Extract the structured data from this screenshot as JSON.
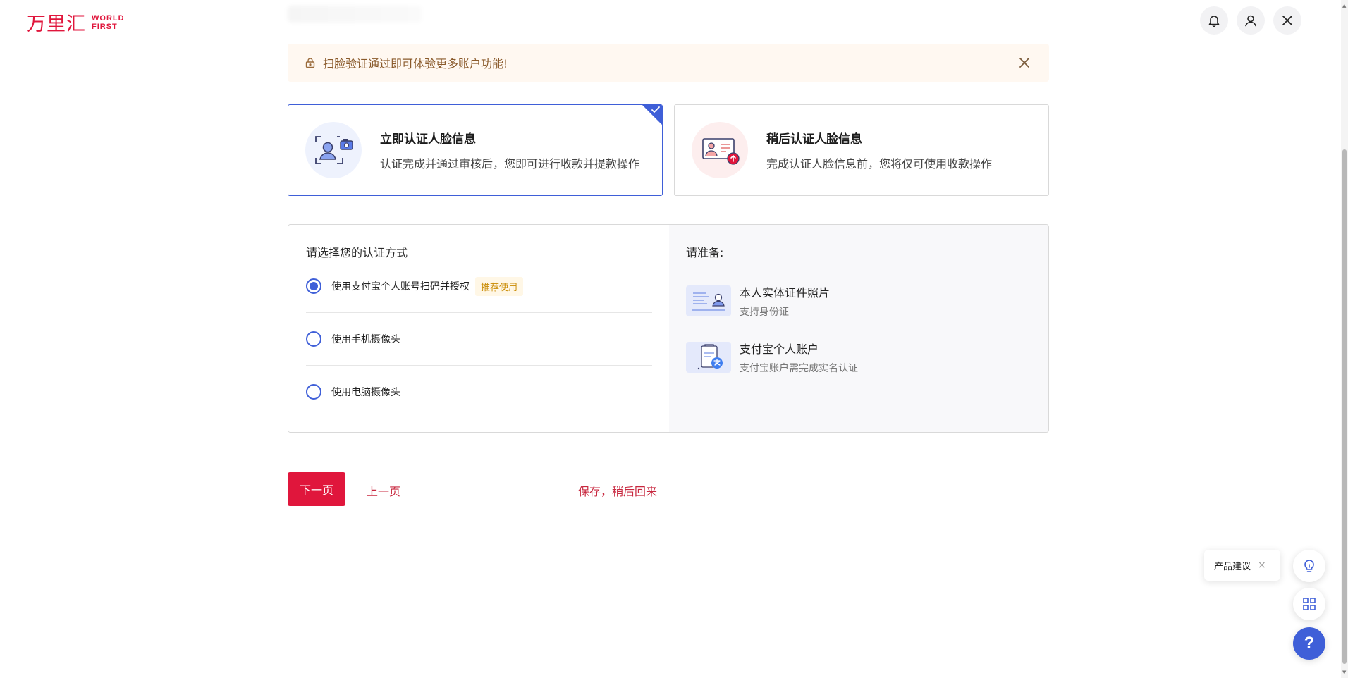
{
  "header": {
    "logo_cn": "万里汇",
    "logo_en_line1": "WORLD",
    "logo_en_line2": "FIRST",
    "icons": [
      "bell-icon",
      "user-icon",
      "close-icon"
    ]
  },
  "notice": {
    "text": "扫脸验证通过即可体验更多账户功能!",
    "icon": "lock-icon"
  },
  "options": [
    {
      "title": "立即认证人脸信息",
      "desc": "认证完成并通过审核后，您即可进行收款并提款操作",
      "selected": true
    },
    {
      "title": "稍后认证人脸信息",
      "desc": "完成认证人脸信息前，您将仅可使用收款操作",
      "selected": false
    }
  ],
  "methods": {
    "heading": "请选择您的认证方式",
    "items": [
      {
        "label": "使用支付宝个人账号扫码并授权",
        "tag": "推荐使用",
        "checked": true
      },
      {
        "label": "使用手机摄像头",
        "checked": false
      },
      {
        "label": "使用电脑摄像头",
        "checked": false
      }
    ]
  },
  "prepare": {
    "heading": "请准备:",
    "items": [
      {
        "title": "本人实体证件照片",
        "sub": "支持身份证"
      },
      {
        "title": "支付宝个人账户",
        "sub": "支付宝账户需完成实名认证"
      }
    ]
  },
  "actions": {
    "next": "下一页",
    "prev": "上一页",
    "save": "保存，稍后回来"
  },
  "floating": {
    "suggest_label": "产品建议",
    "suggest_close": "×",
    "help": "?"
  },
  "colors": {
    "brand": "#e0163c",
    "accent": "#3f5fd8",
    "notice_bg": "#fff8f1"
  }
}
